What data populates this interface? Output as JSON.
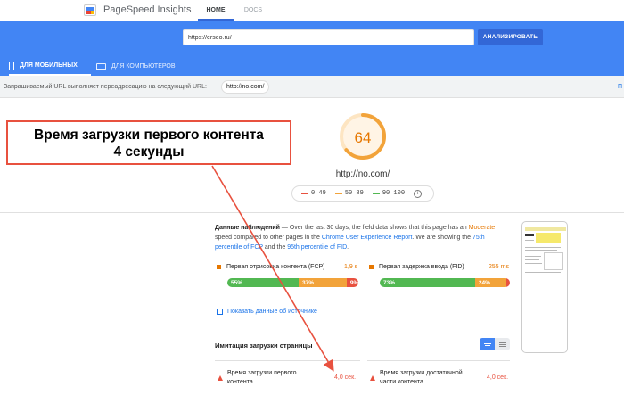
{
  "app": {
    "brand": "PageSpeed Insights",
    "nav": [
      "HOME",
      "DOCS"
    ]
  },
  "search": {
    "url_value": "https://erseo.ru/",
    "button_label": "АНАЛИЗИРОВАТЬ"
  },
  "devices": {
    "mobile": "ДЛЯ МОБИЛЬНЫХ",
    "desktop": "ДЛЯ КОМПЬЮТЕРОВ"
  },
  "redirect": {
    "text": "Запрашиваемый URL выполняет переадресацию на следующий URL:",
    "url": "http://no.com/",
    "more": "П"
  },
  "score": {
    "value": "64",
    "host": "http://no.com/",
    "legend": [
      "0–49",
      "50–89",
      "90–100"
    ],
    "legend_colors": [
      "#e8513f",
      "#f2a33a",
      "#52b852"
    ],
    "gauge_fraction": 0.64,
    "gauge_color": "#f2a33a"
  },
  "field_data": {
    "title": "Данные наблюдений",
    "text1": " — Over the last 30 days, the field data shows that this page has an ",
    "moderate": "Moderate",
    "text2": " speed compared to other pages in the ",
    "report": "Chrome User Experience Report",
    "text3": ". We are showing the ",
    "fcp_link": "75th percentile of FCP",
    "text4": " and the ",
    "fid_link": "95th percentile of FID",
    "text5": "."
  },
  "metrics": {
    "fcp": {
      "label": "Первая отрисовка контента (FCP)",
      "value": "1,9 s",
      "dist": [
        "55%",
        "37%",
        "9%"
      ],
      "shares": [
        55,
        37,
        9
      ]
    },
    "fid": {
      "label": "Первая задержка ввода (FID)",
      "value": "255 ms",
      "dist": [
        "73%",
        "24%",
        "2%"
      ],
      "shares": [
        73,
        24,
        2
      ]
    }
  },
  "origin": {
    "label": "Показать данные об источнике"
  },
  "lab": {
    "title": "Имитация загрузки страницы",
    "fcp_label": "Время загрузки первого контента",
    "fcp_value": "4,0 сек.",
    "tti_label": "Время загрузки достаточной части контента",
    "tti_value": "4,0 сек."
  },
  "annotation": {
    "line1": "Время загрузки первого контента",
    "line2": "4 секунды"
  },
  "colors": {
    "accent": "#4285f4",
    "accent_dark": "#3367d6",
    "average": "#e67700",
    "fail": "#e8513f",
    "pass": "#52b852"
  }
}
